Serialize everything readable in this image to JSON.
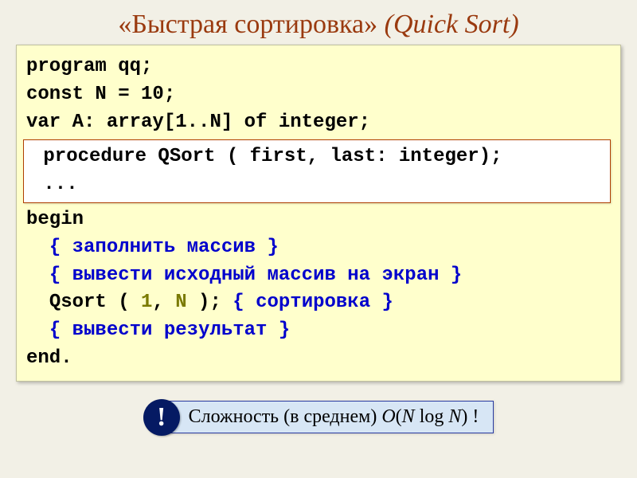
{
  "title": {
    "ru": "«Быстрая сортировка»",
    "en": "(Quick Sort)"
  },
  "code": {
    "line1": "program qq;",
    "line2": "const N = 10;",
    "line3": "var A: array[1..N] of integer;",
    "inner1": " procedure QSort ( first, last: integer);",
    "inner2": " ...",
    "line4": "begin",
    "line5_pre": "  ",
    "line5": "{ заполнить массив }",
    "line6_pre": "  ",
    "line6": "{ вывести исходный массив на экран }",
    "line7_pre": "  ",
    "line7a": "Qsort ( ",
    "line7b1": "1",
    "line7c": ", ",
    "line7b2": "N",
    "line7d": " );",
    "line7sp": " ",
    "line7e": "{ сортировка }",
    "line8_pre": "  ",
    "line8": "{ вывести результат }",
    "line9": "end."
  },
  "footer": {
    "exclaim": "!",
    "label": "Сложность (в среднем) ",
    "formula_O": "O",
    "formula_open": "(",
    "formula_N": "N",
    "formula_sp": " ",
    "formula_log": "log",
    "formula_N2": "N",
    "formula_close": ")",
    "tail": " !"
  }
}
